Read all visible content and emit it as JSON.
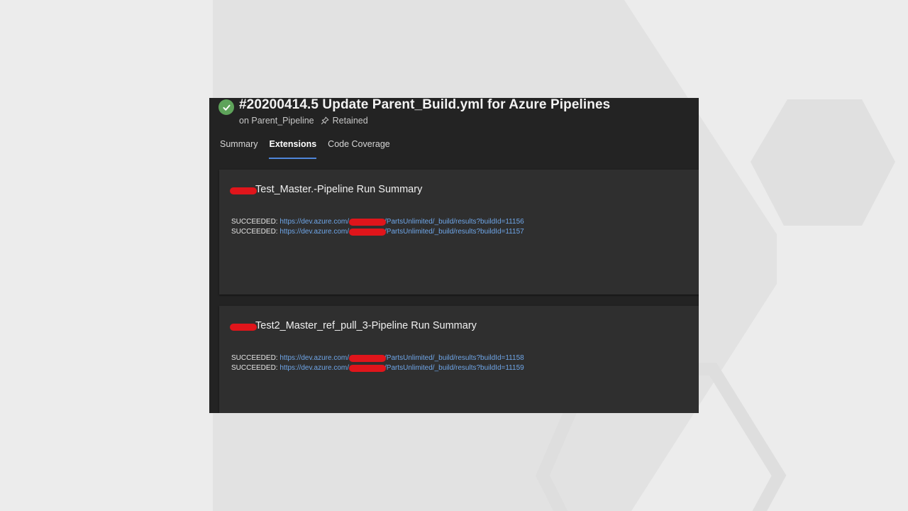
{
  "run": {
    "title": "#20200414.5 Update Parent_Build.yml for Azure Pipelines",
    "pipeline_prefix": "on Parent_Pipeline",
    "retained_label": "Retained"
  },
  "tabs": [
    {
      "label": "Summary",
      "active": false
    },
    {
      "label": "Extensions",
      "active": true
    },
    {
      "label": "Code Coverage",
      "active": false
    }
  ],
  "cards": [
    {
      "title": "Test_Master.-Pipeline Run Summary",
      "results": [
        {
          "status": "SUCCEEDED:",
          "link_start": "https://dev.azure.com/",
          "link_end": "/PartsUnlimited/_build/results?buildId=11156"
        },
        {
          "status": "SUCCEEDED:",
          "link_start": "https://dev.azure.com/",
          "link_end": "/PartsUnlimited/_build/results?buildId=11157"
        }
      ]
    },
    {
      "title": "Test2_Master_ref_pull_3-Pipeline Run Summary",
      "results": [
        {
          "status": "SUCCEEDED:",
          "link_start": "https://dev.azure.com/",
          "link_end": "/PartsUnlimited/_build/results?buildId=11158"
        },
        {
          "status": "SUCCEEDED:",
          "link_start": "https://dev.azure.com/",
          "link_end": "/PartsUnlimited/_build/results?buildId=11159"
        }
      ]
    }
  ],
  "colors": {
    "success": "#5ea35a",
    "link": "#6fa6e8",
    "tab_indicator": "#4f86d9",
    "redaction": "#e0151b"
  },
  "icons": [
    "success-check-icon",
    "pin-icon"
  ]
}
